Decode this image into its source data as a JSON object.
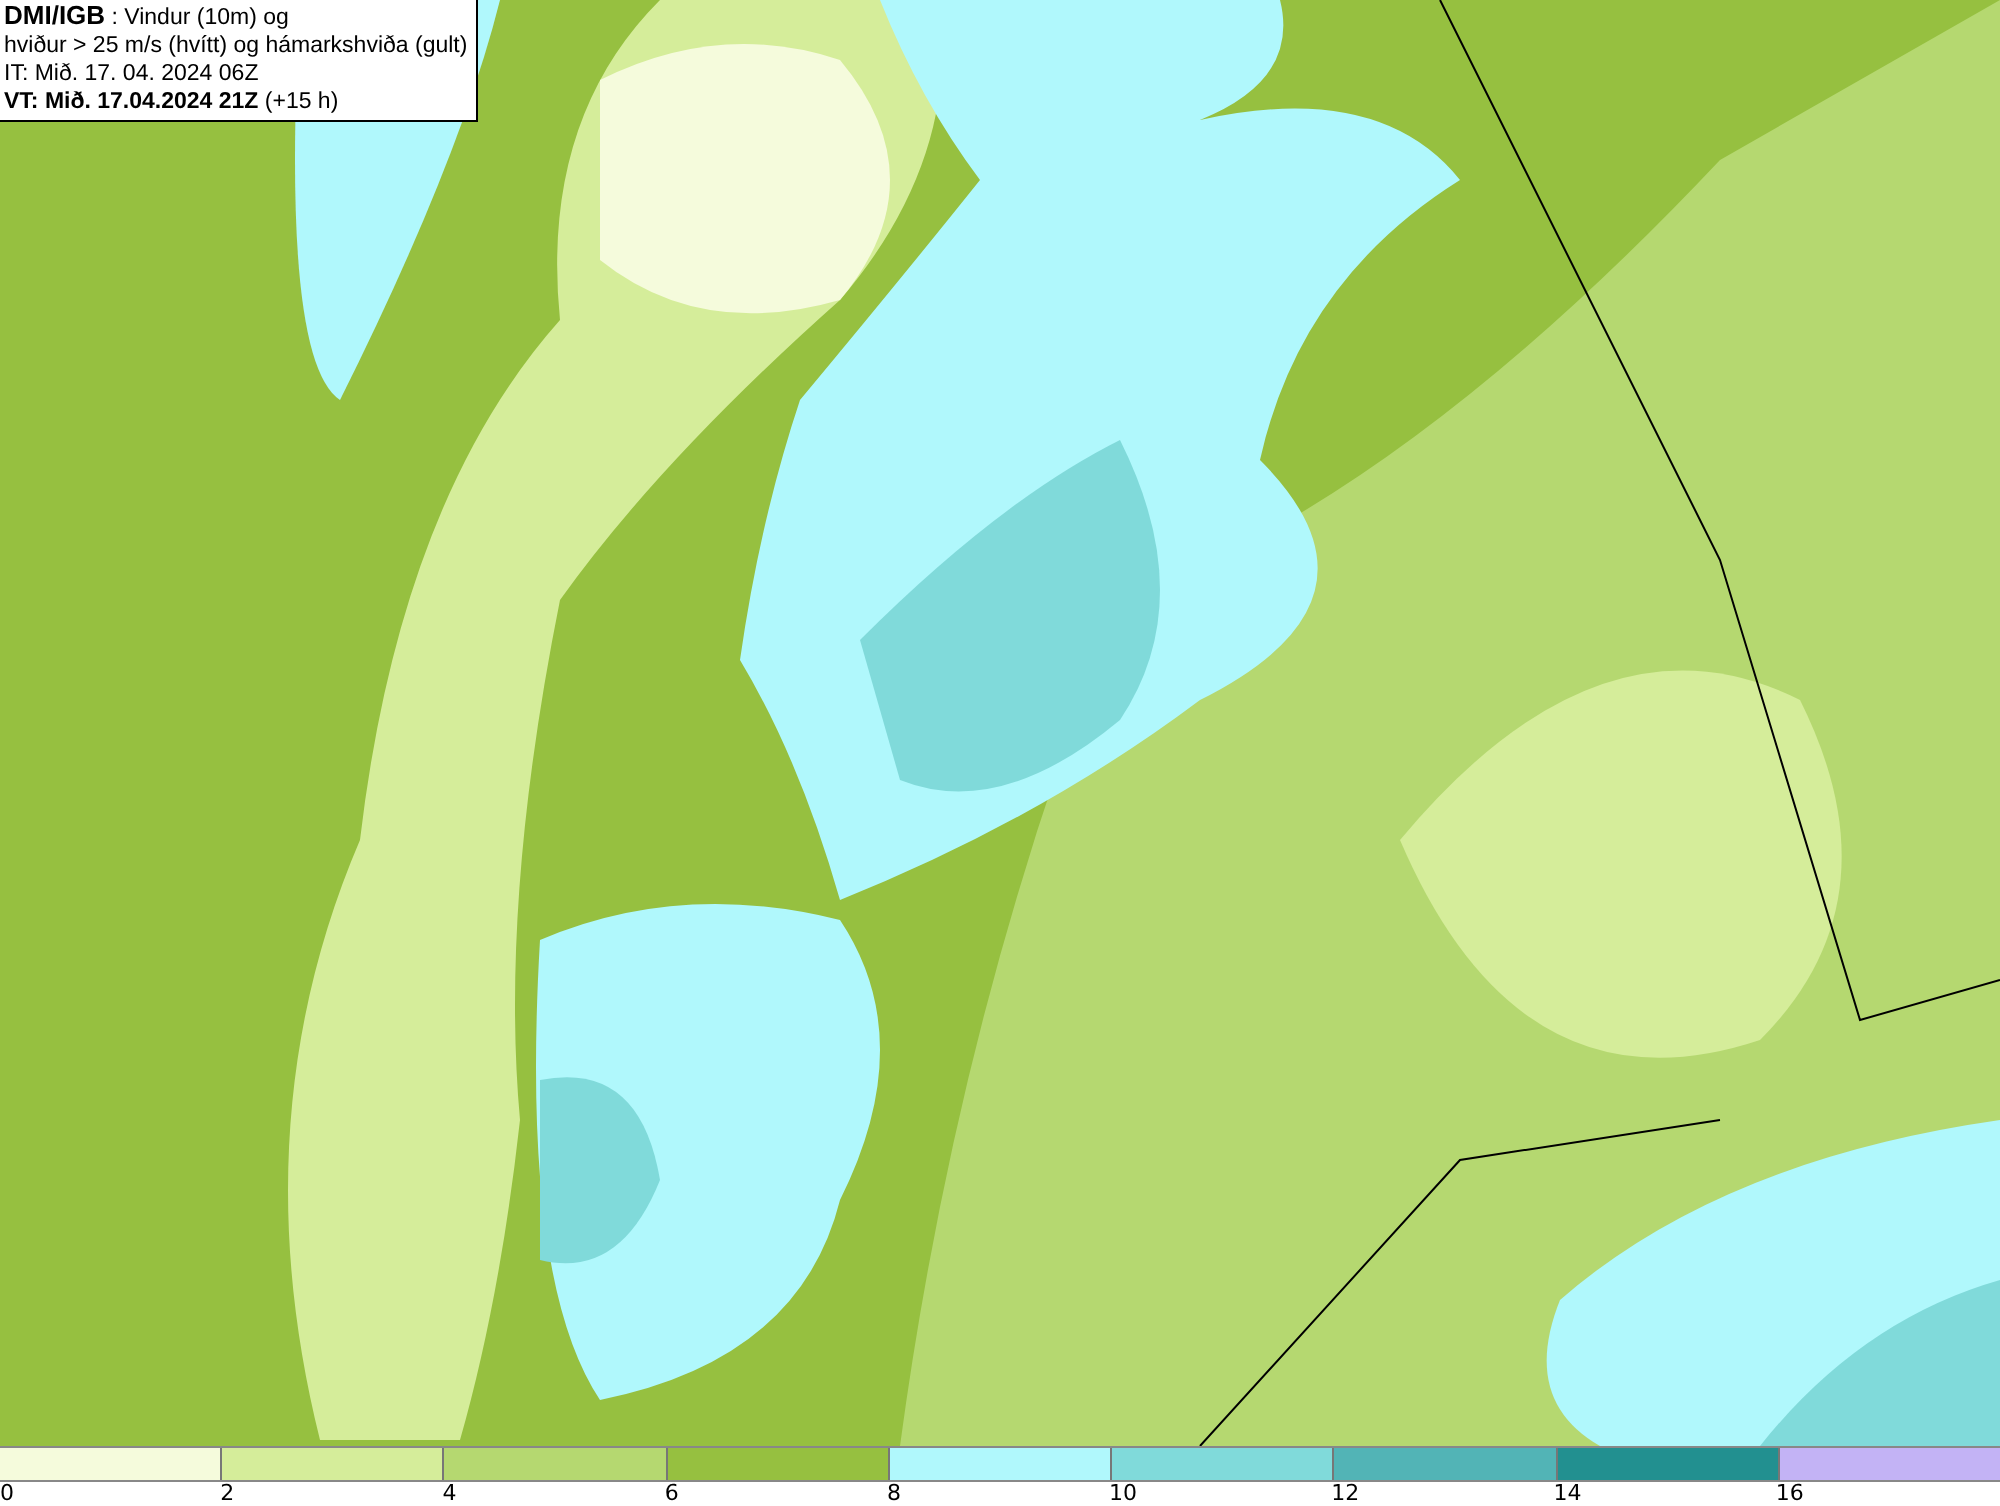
{
  "title_box": {
    "lines": [
      "**DMI/IGB** : Vindur (10m) og",
      "hviður > 25 m/s (hvítt) og hámarkshviða (gult)",
      "IT: Mið. 17. 04. 2024 06Z",
      "**VT: Mið. 17.04.2024 21Z** (+15 h)"
    ]
  },
  "legend": {
    "bins": [
      {
        "label": "0",
        "color": "#f5fbdc"
      },
      {
        "label": "2",
        "color": "#d5ed9a"
      },
      {
        "label": "4",
        "color": "#b5d870"
      },
      {
        "label": "6",
        "color": "#96c040"
      },
      {
        "label": "8",
        "color": "#b0f8fc"
      },
      {
        "label": "10",
        "color": "#80dada"
      },
      {
        "label": "12",
        "color": "#52b4b6"
      },
      {
        "label": "14",
        "color": "#229090"
      },
      {
        "label": "16",
        "color": "#c3b3f5"
      }
    ]
  }
}
